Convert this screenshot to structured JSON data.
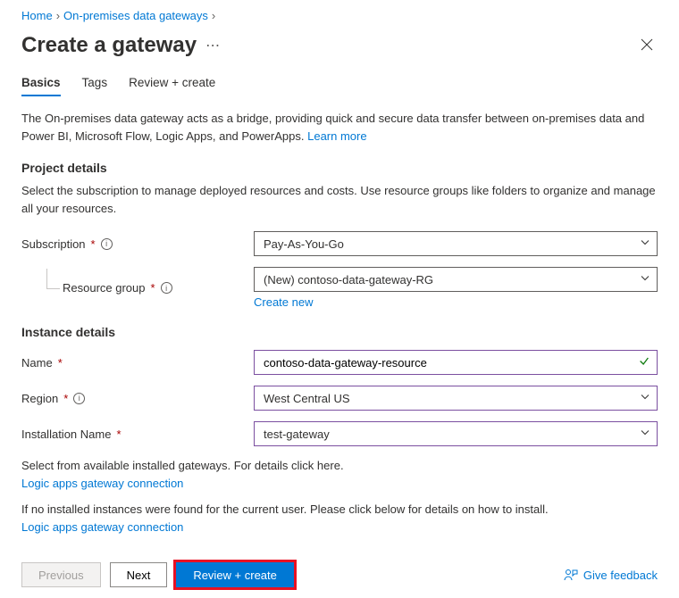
{
  "breadcrumb": {
    "home": "Home",
    "gateways": "On-premises data gateways"
  },
  "title": "Create a gateway",
  "tabs": {
    "basics": "Basics",
    "tags": "Tags",
    "review": "Review + create"
  },
  "description": {
    "text": "The On-premises data gateway acts as a bridge, providing quick and secure data transfer between on-premises data and Power BI, Microsoft Flow, Logic Apps, and PowerApps.",
    "learn_more": "Learn more"
  },
  "project": {
    "heading": "Project details",
    "desc": "Select the subscription to manage deployed resources and costs. Use resource groups like folders to organize and manage all your resources.",
    "subscription_label": "Subscription",
    "subscription_value": "Pay-As-You-Go",
    "resource_group_label": "Resource group",
    "resource_group_value": "(New) contoso-data-gateway-RG",
    "create_new": "Create new"
  },
  "instance": {
    "heading": "Instance details",
    "name_label": "Name",
    "name_value": "contoso-data-gateway-resource",
    "region_label": "Region",
    "region_value": "West Central US",
    "install_label": "Installation Name",
    "install_value": "test-gateway"
  },
  "help": {
    "line1": "Select from available installed gateways. For details click here.",
    "link": "Logic apps gateway connection",
    "line2": "If no installed instances were found for the current user. Please click below for details on how to install."
  },
  "footer": {
    "previous": "Previous",
    "next": "Next",
    "review": "Review + create",
    "feedback": "Give feedback"
  }
}
